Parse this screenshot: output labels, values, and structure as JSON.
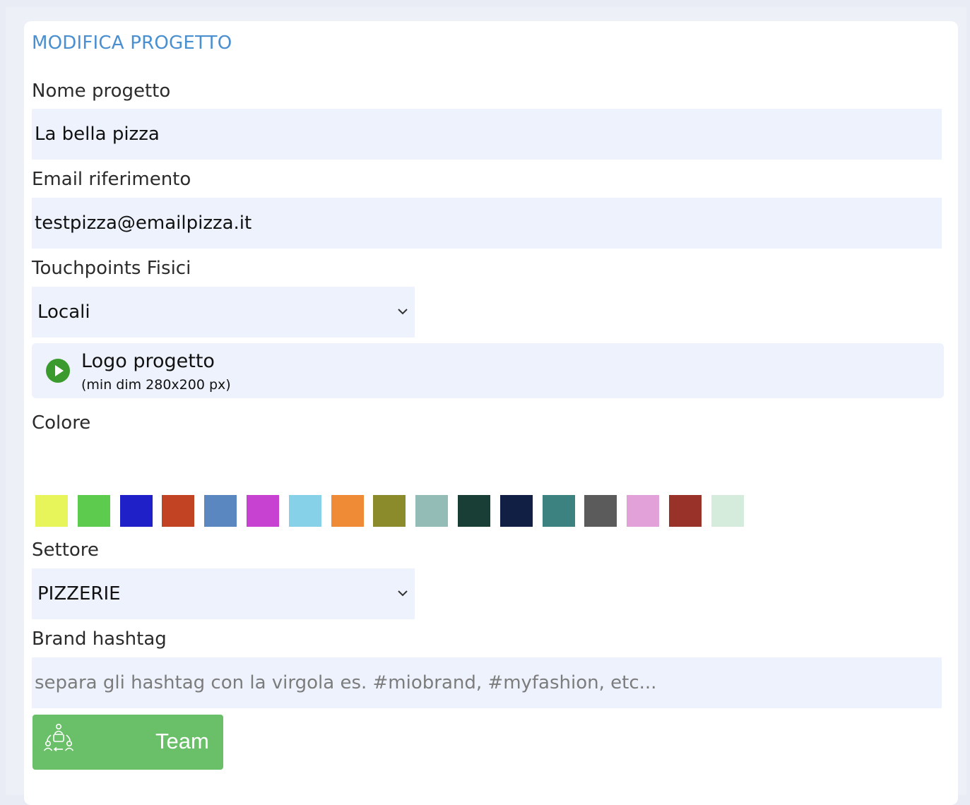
{
  "form": {
    "title": "MODIFICA PROGETTO",
    "project_name": {
      "label": "Nome progetto",
      "value": "La bella pizza"
    },
    "email": {
      "label": "Email riferimento",
      "value": "testpizza@emailpizza.it"
    },
    "touchpoints": {
      "label": "Touchpoints Fisici",
      "selected": "Locali"
    },
    "logo": {
      "title": "Logo progetto",
      "subtitle": "(min dim 280x200 px)",
      "icon": "play-circle-icon"
    },
    "color": {
      "label": "Colore",
      "swatches": [
        "#e8f55a",
        "#5ccb4e",
        "#2020c8",
        "#c24224",
        "#5b87c0",
        "#c842d2",
        "#86d1e8",
        "#ef8b36",
        "#8b8b2c",
        "#93bcb7",
        "#183e35",
        "#111f45",
        "#3b8280",
        "#5b5b5b",
        "#e3a1da",
        "#993329",
        "#d5ebdc"
      ]
    },
    "sector": {
      "label": "Settore",
      "selected": "PIZZERIE"
    },
    "hashtag": {
      "label": "Brand hashtag",
      "placeholder": "separa gli hashtag con la virgola es. #miobrand, #myfashion, etc...",
      "value": ""
    },
    "team_button": {
      "label": "Team",
      "icon": "team-cycle-icon"
    }
  },
  "colors": {
    "accent": "#4a8fd0",
    "field_bg": "#edf2fd",
    "button_green": "#6abf69",
    "play_green": "#3a9a2e"
  }
}
